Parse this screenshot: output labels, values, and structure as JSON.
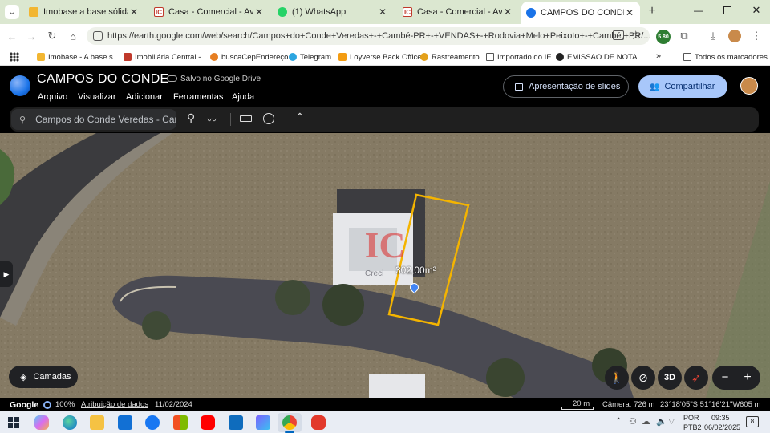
{
  "browser": {
    "tabs": [
      {
        "title": "Imobase a base sólida para",
        "icon_color": "#f2b632"
      },
      {
        "title": "Casa - Comercial - Av. Santo",
        "icon_color": "#c0392b"
      },
      {
        "title": "(1) WhatsApp",
        "icon_color": "#25d366"
      },
      {
        "title": "Casa - Comercial - Av. Santo",
        "icon_color": "#c0392b"
      },
      {
        "title": "CAMPOS DO CONDE – Goo",
        "icon_color": "#1a73e8"
      }
    ],
    "url": "https://earth.google.com/web/search/Campos+do+Conde+Veredas+-+Cambé-PR+-+VENDAS+-+Rodovia+Melo+Peixoto+-+Cambé,+PR/...",
    "extension_badge": "5.80",
    "bookmarks": [
      "Imobase - A base s...",
      "Imobiliária Central -...",
      "buscaCepEndereço",
      "Telegram",
      "Loyverse Back Office",
      "Rastreamento",
      "Importado do IE",
      "EMISSAO DE NOTA..."
    ],
    "all_bookmarks": "Todos os marcadores"
  },
  "earth": {
    "project_title": "CAMPOS DO CONDE",
    "saved_status": "Salvo no Google Drive",
    "menu": [
      "Arquivo",
      "Visualizar",
      "Adicionar",
      "Ferramentas",
      "Ajuda"
    ],
    "slideshow_label": "Apresentação de slides",
    "share_label": "Compartilhar",
    "search_value": "Campos do Conde Veredas - Cam",
    "measurement": "302,00m²",
    "layers_label": "Camadas",
    "btn_3d": "3D",
    "logo_text": "Google",
    "zoom_percent": "100%",
    "attribution": "Atribuição de dados",
    "imagery_date": "11/02/2024",
    "scale": "20 m",
    "camera": "Câmera: 726 m",
    "coords": "23°18'05\"S 51°16'21\"W",
    "elevation": "605 m",
    "watermark_fragment": "Creci"
  },
  "taskbar": {
    "lang1": "POR",
    "lang2": "PTB2",
    "time": "09:35",
    "date": "06/02/2025",
    "notifications": "8"
  },
  "colors": {
    "accent": "#1a73e8",
    "polygon": "#f4b400",
    "share_bg": "#a8c7fa"
  }
}
